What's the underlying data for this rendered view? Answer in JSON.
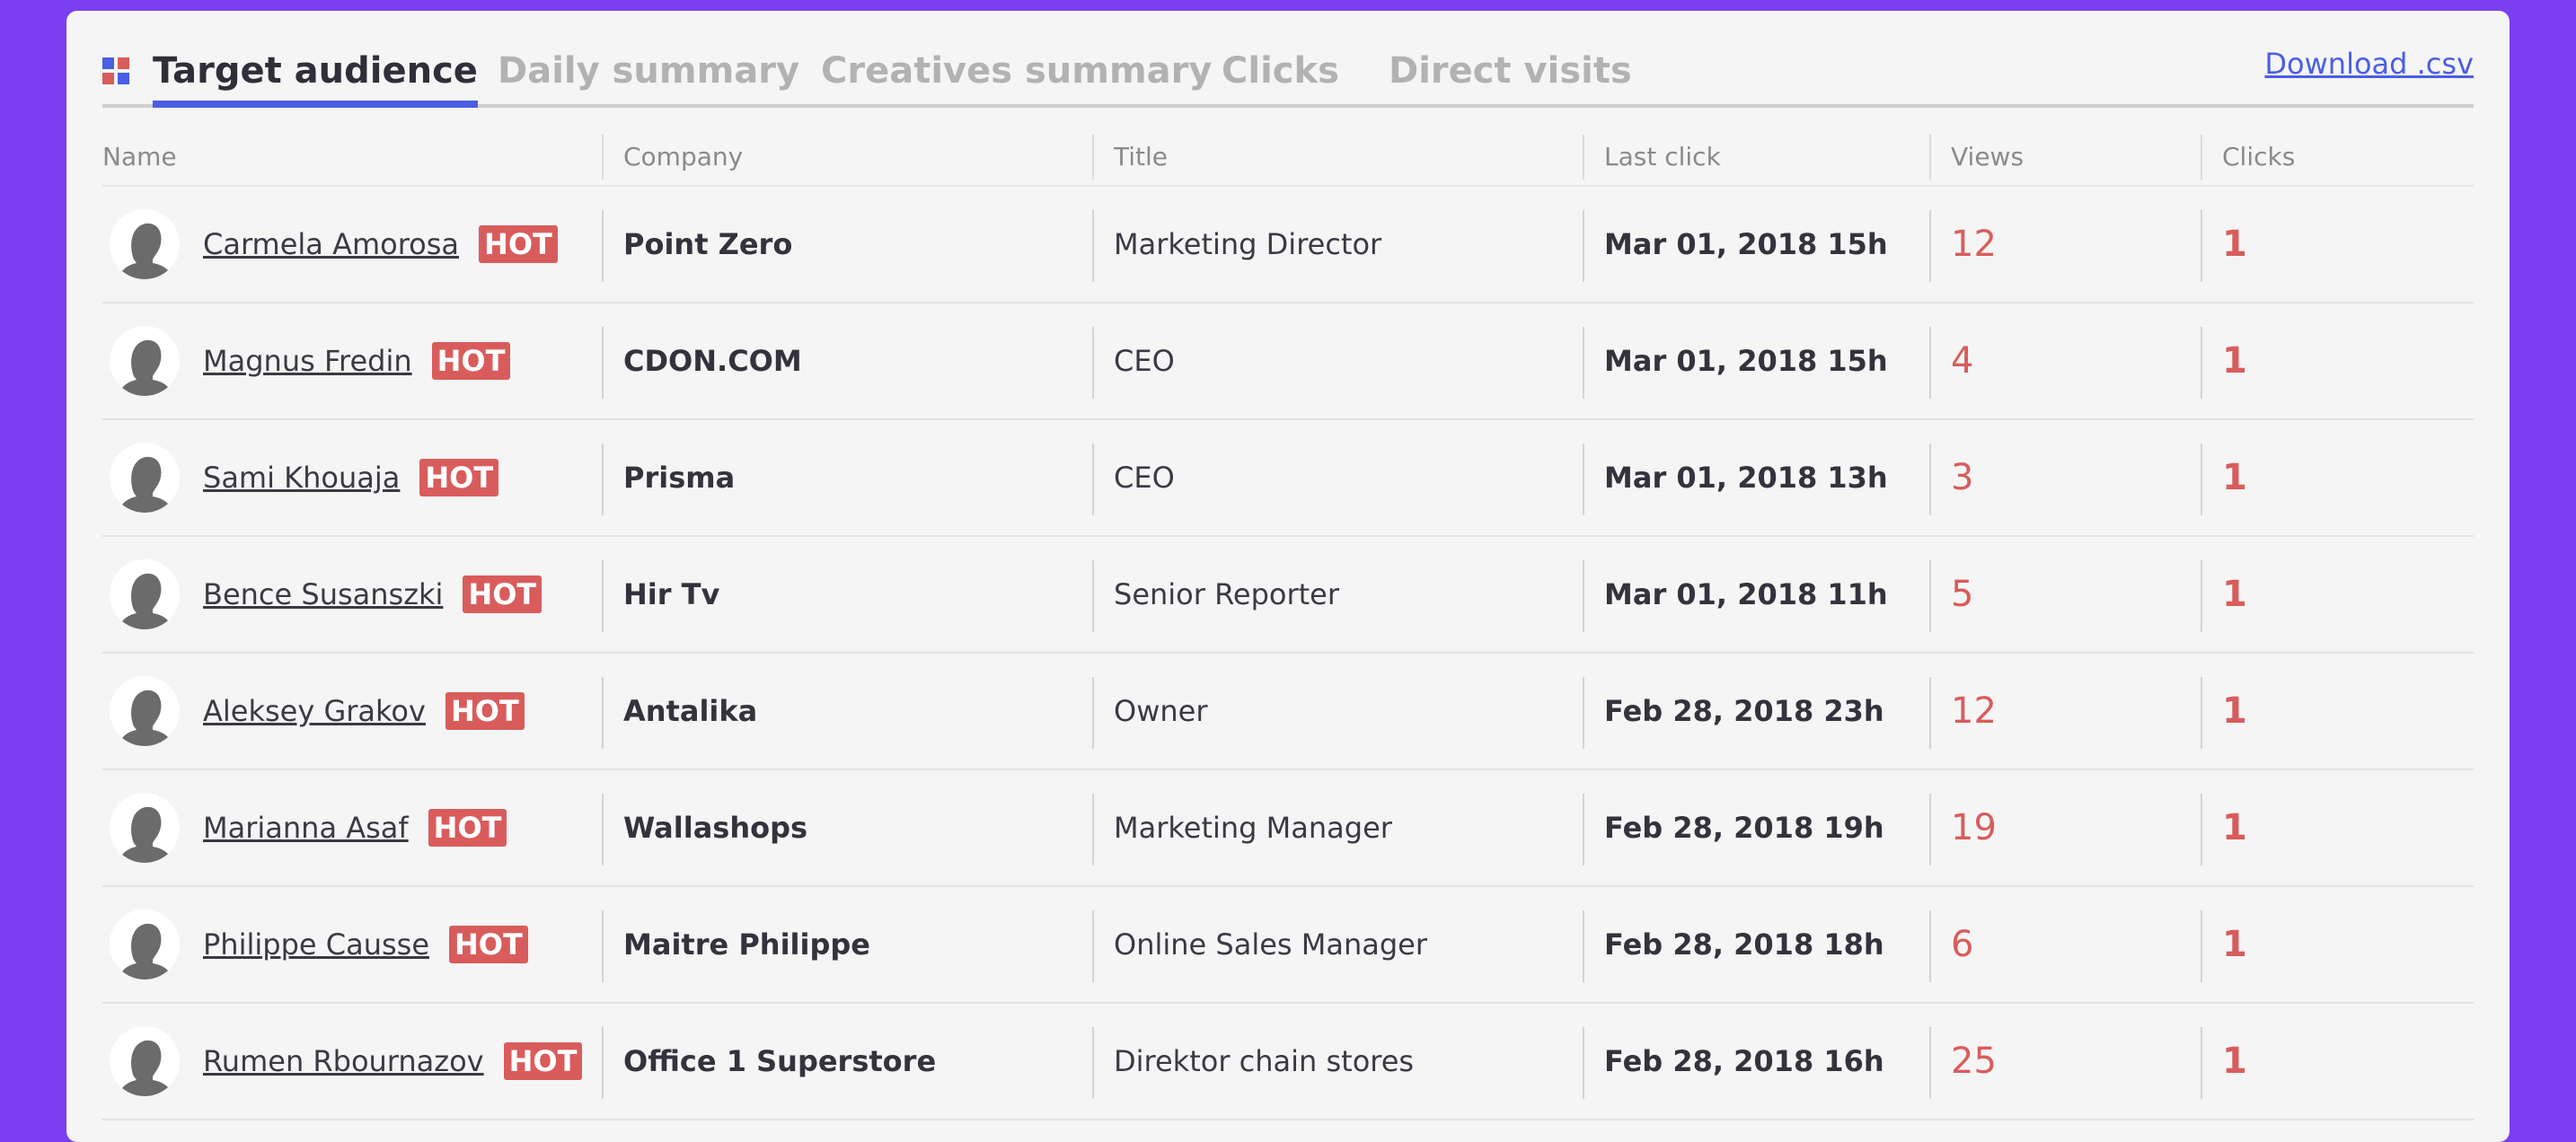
{
  "tabs": [
    {
      "label": "Target audience",
      "active": true
    },
    {
      "label": "Daily summary",
      "active": false
    },
    {
      "label": "Creatives summary",
      "active": false
    },
    {
      "label": "Clicks",
      "active": false
    },
    {
      "label": "Direct visits",
      "active": false
    }
  ],
  "download_label": "Download .csv",
  "columns": [
    "Name",
    "Company",
    "Title",
    "Last click",
    "Views",
    "Clicks"
  ],
  "badge_label": "HOT",
  "colors": {
    "background": "#7b3ff2",
    "accent": "#4a5ee6",
    "hot": "#d95c5c"
  },
  "rows": [
    {
      "name": "Carmela Amorosa",
      "company": "Point Zero",
      "title": "Marketing Director",
      "last_click": "Mar 01, 2018 15h",
      "views": "12",
      "clicks": "1"
    },
    {
      "name": "Magnus Fredin",
      "company": "CDON.COM",
      "title": "CEO",
      "last_click": "Mar 01, 2018 15h",
      "views": "4",
      "clicks": "1"
    },
    {
      "name": "Sami Khouaja",
      "company": "Prisma",
      "title": "CEO",
      "last_click": "Mar 01, 2018 13h",
      "views": "3",
      "clicks": "1"
    },
    {
      "name": "Bence Susanszki",
      "company": "Hir Tv",
      "title": "Senior Reporter",
      "last_click": "Mar 01, 2018 11h",
      "views": "5",
      "clicks": "1"
    },
    {
      "name": "Aleksey Grakov",
      "company": "Antalika",
      "title": "Owner",
      "last_click": "Feb 28, 2018 23h",
      "views": "12",
      "clicks": "1"
    },
    {
      "name": "Marianna Asaf",
      "company": "Wallashops",
      "title": "Marketing Manager",
      "last_click": "Feb 28, 2018 19h",
      "views": "19",
      "clicks": "1"
    },
    {
      "name": "Philippe Causse",
      "company": "Maitre Philippe",
      "title": "Online Sales Manager",
      "last_click": "Feb 28, 2018 18h",
      "views": "6",
      "clicks": "1"
    },
    {
      "name": "Rumen Rbournazov",
      "company": "Office 1 Superstore",
      "title": "Direktor chain stores",
      "last_click": "Feb 28, 2018 16h",
      "views": "25",
      "clicks": "1"
    }
  ]
}
